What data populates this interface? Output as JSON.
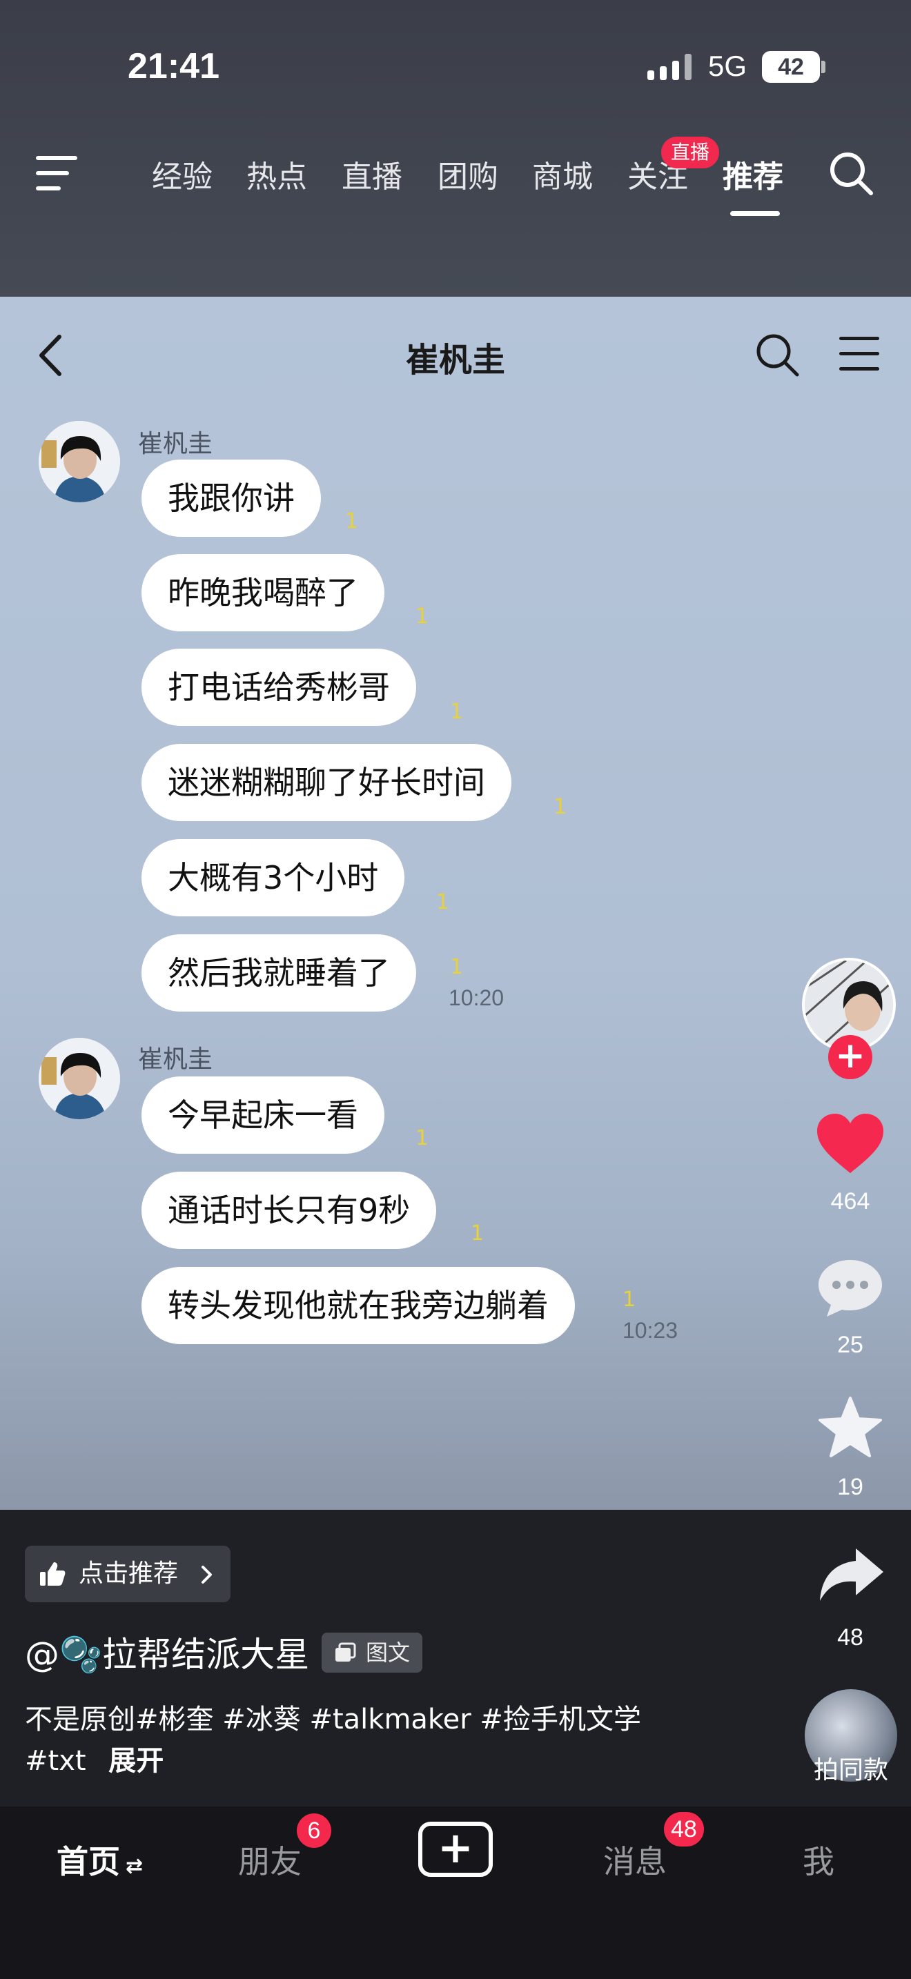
{
  "status_bar": {
    "time": "21:41",
    "network": "5G",
    "battery": "42"
  },
  "top_nav": {
    "tabs": [
      "经验",
      "热点",
      "直播",
      "团购",
      "商城",
      "关注",
      "推荐"
    ],
    "live_badge": "直播",
    "active_tab": "推荐"
  },
  "chat": {
    "title": "崔杋圭",
    "groups": [
      {
        "sender": "崔杋圭",
        "messages": [
          {
            "text": "我跟你讲",
            "read": "1"
          },
          {
            "text": "昨晚我喝醉了",
            "read": "1"
          },
          {
            "text": "打电话给秀彬哥",
            "read": "1"
          },
          {
            "text": "迷迷糊糊聊了好长时间",
            "read": "1"
          },
          {
            "text": "大概有3个小时",
            "read": "1"
          },
          {
            "text": "然后我就睡着了",
            "read": "1",
            "time": "10:20"
          }
        ]
      },
      {
        "sender": "崔杋圭",
        "messages": [
          {
            "text": "今早起床一看",
            "read": "1"
          },
          {
            "text": "通话时长只有9秒",
            "read": "1"
          },
          {
            "text": "转头发现他就在我旁边躺着",
            "read": "1",
            "time": "10:23"
          }
        ]
      }
    ]
  },
  "right_rail": {
    "likes": "464",
    "comments": "25",
    "favorites": "19",
    "shares": "48",
    "remix_label": "拍同款",
    "like_color": "#f5294f"
  },
  "post": {
    "recommend_label": "点击推荐",
    "author": "@🫧拉帮结派大星",
    "type_badge": "图文",
    "description": "不是原创#彬奎 #冰葵 #talkmaker #捡手机文学",
    "description_line2": "#txt",
    "expand_label": "展开"
  },
  "bottom_nav": {
    "home": "首页",
    "friends": "朋友",
    "friends_badge": "6",
    "plus": "+",
    "messages": "消息",
    "messages_badge": "48",
    "me": "我"
  }
}
